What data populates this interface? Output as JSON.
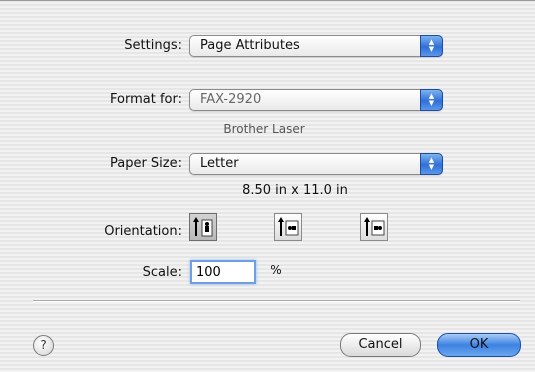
{
  "settings": {
    "label": "Settings:",
    "value": "Page Attributes"
  },
  "format_for": {
    "label": "Format for:",
    "value": "FAX-2920",
    "description": "Brother Laser"
  },
  "paper_size": {
    "label": "Paper Size:",
    "value": "Letter",
    "dimensions": "8.50 in x 11.0 in"
  },
  "orientation": {
    "label": "Orientation:",
    "options": [
      "portrait-icon",
      "landscape-left-icon",
      "landscape-right-icon"
    ],
    "selected": "portrait-icon"
  },
  "scale": {
    "label": "Scale:",
    "value": "100",
    "unit": "%"
  },
  "buttons": {
    "help": "?",
    "cancel": "Cancel",
    "ok": "OK"
  },
  "colors": {
    "accent": "#3d82e3",
    "focus_ring": "#6f9fe0"
  }
}
